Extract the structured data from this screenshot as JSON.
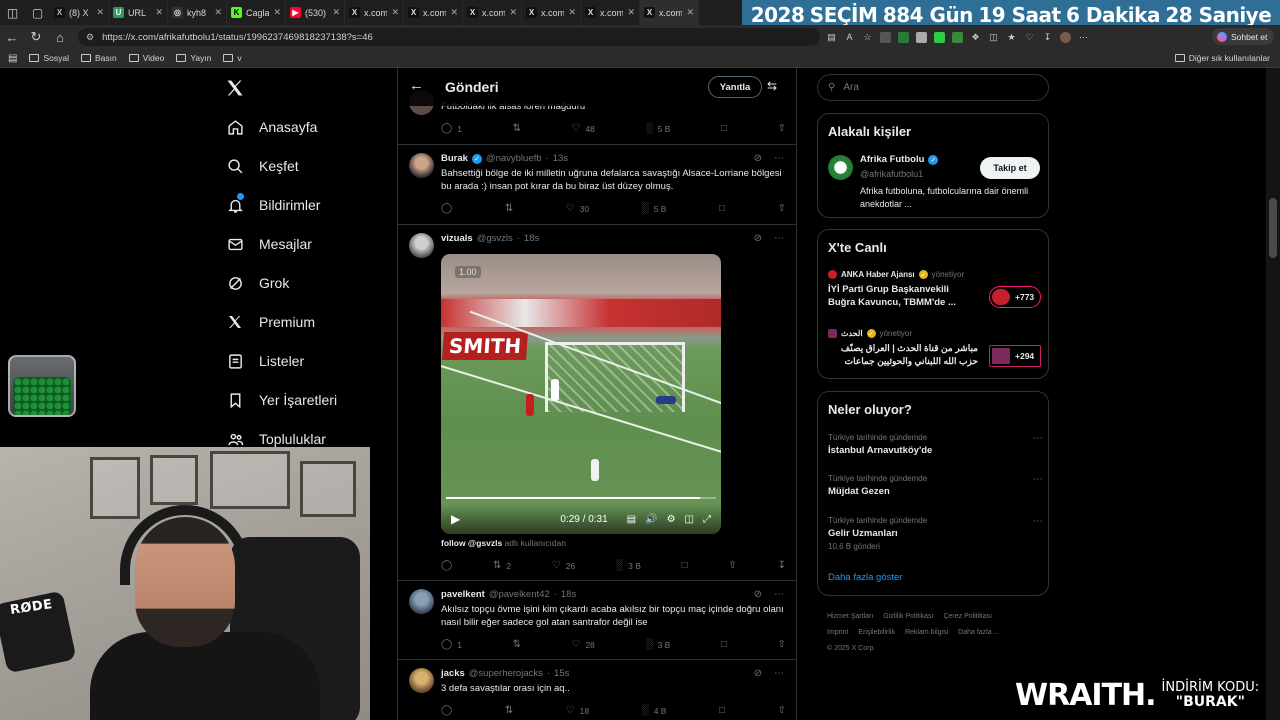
{
  "browser": {
    "tabs": [
      {
        "title": "(8) X",
        "fav": "X",
        "favColor": "#b8b8b8",
        "favBg": "#111"
      },
      {
        "title": "URL",
        "fav": "U",
        "favColor": "#fff",
        "favBg": "#2c9c58"
      },
      {
        "title": "kyh8",
        "fav": "◎",
        "favColor": "#ddd",
        "favBg": "#333"
      },
      {
        "title": "Cagla",
        "fav": "K",
        "favColor": "#000",
        "favBg": "#53fc18"
      },
      {
        "title": "(530)",
        "fav": "▶",
        "favColor": "#fff",
        "favBg": "#ff0033"
      },
      {
        "title": "x.com",
        "fav": "X",
        "favColor": "#ddd",
        "favBg": "#111"
      },
      {
        "title": "x.com",
        "fav": "X",
        "favColor": "#ddd",
        "favBg": "#111"
      },
      {
        "title": "x.com",
        "fav": "X",
        "favColor": "#ddd",
        "favBg": "#111"
      },
      {
        "title": "x.com",
        "fav": "X",
        "favColor": "#ddd",
        "favBg": "#111"
      },
      {
        "title": "x.com",
        "fav": "X",
        "favColor": "#ddd",
        "favBg": "#111"
      },
      {
        "title": "x.com",
        "fav": "X",
        "favColor": "#ddd",
        "favBg": "#111"
      }
    ],
    "url": "https://x.com/afrikafutbolu1/status/1996237469818237138?s=46",
    "bookmarks": [
      "Sosyal",
      "Basın",
      "Video",
      "Yayın",
      "v"
    ],
    "bookmarks_other": "Diğer sık kullanılanlar",
    "chat_label": "Sohbet et"
  },
  "election": {
    "year": "2028",
    "label": "SEÇİM",
    "days": "884 Gün",
    "hours": "19 Saat",
    "minutes": "6 Dakika",
    "seconds": "28 Saniye"
  },
  "nav": {
    "items": [
      {
        "label": "Anasayfa",
        "icon": "home-icon"
      },
      {
        "label": "Keşfet",
        "icon": "search-icon"
      },
      {
        "label": "Bildirimler",
        "icon": "bell-icon"
      },
      {
        "label": "Mesajlar",
        "icon": "mail-icon"
      },
      {
        "label": "Grok",
        "icon": "grok-icon"
      },
      {
        "label": "Premium",
        "icon": "x-icon"
      },
      {
        "label": "Listeler",
        "icon": "list-icon"
      },
      {
        "label": "Yer İşaretleri",
        "icon": "bookmark-icon"
      },
      {
        "label": "Topluluklar",
        "icon": "people-icon"
      }
    ]
  },
  "header": {
    "title": "Gönderi",
    "reply_label": "Yanıtla"
  },
  "tweets": [
    {
      "text": "Futboldaki ilk alsas loren mağduru",
      "replies": "1",
      "retweets": "",
      "likes": "48",
      "views": "5 B"
    },
    {
      "name": "Burak",
      "handle": "@navybluefb",
      "time": "13s",
      "text": "Bahsettiği bölge de iki milletin uğruna defalarca savaştığı Alsace-Lorriane bölgesi bu arada :) insan pot kırar da bu biraz üst düzey olmuş.",
      "replies": "",
      "retweets": "",
      "likes": "30",
      "views": "5 B"
    },
    {
      "name": "vizuals",
      "handle": "@gsvzls",
      "time": "18s",
      "replies": "",
      "retweets": "2",
      "likes": "26",
      "views": "3 B",
      "video": {
        "speed": "1.00",
        "time": "0:29 / 0:31",
        "progress": 0.94,
        "board_text": "SMITH"
      },
      "caption_user": "follow @gsvzls",
      "caption_sub": "adlı kullanıcıdan"
    },
    {
      "name": "pavelkent",
      "handle": "@pavelkent42",
      "time": "18s",
      "text": "Akılsız topçu övme işini kim çıkardı acaba akılsız bir topçu maç içinde doğru olanı nasıl bilir eğer sadece gol atan santrafor değil ise",
      "replies": "1",
      "retweets": "",
      "likes": "28",
      "views": "3 B"
    },
    {
      "name": "jacks",
      "handle": "@superherojacks",
      "time": "15s",
      "text": "3 defa savaştılar orası için aq..",
      "replies": "",
      "retweets": "",
      "likes": "18",
      "views": "4 B"
    }
  ],
  "right": {
    "search_placeholder": "Ara",
    "related_title": "Alakalı kişiler",
    "related": {
      "name": "Afrika Futbolu",
      "handle": "@afrikafutbolu1",
      "bio": "Afrika futboluna, futbolcularına dair önemli anekdotlar ...",
      "follow_label": "Takip et"
    },
    "live_title": "X'te Canlı",
    "live": [
      {
        "source": "ANKA Haber Ajansı",
        "status": "yönetiyor",
        "title": "İYİ Parti Grup Başkanvekili Buğra Kavuncu, TBMM'de ...",
        "count": "+773",
        "thumb": "#c8202a"
      },
      {
        "source": "الحدث",
        "status": "yönetiyor",
        "title": "مباشر من قناة الحدث | العراق يصنّف حزب الله اللبناني والحوثيين جماعات",
        "count": "+294",
        "thumb": "#7a2a5a"
      }
    ],
    "trends_title": "Neler oluyor?",
    "trends": [
      {
        "category": "Türkiye tarihinde gündemde",
        "title": "İstanbul Arnavutköy'de",
        "count": ""
      },
      {
        "category": "Türkiye tarihinde gündemde",
        "title": "Müjdat Gezen",
        "count": ""
      },
      {
        "category": "Türkiye tarihinde gündemde",
        "title": "Gelir Uzmanları",
        "count": "10,6 B gönderi"
      }
    ],
    "show_more": "Daha fazla göster",
    "footer": [
      "Hizmet Şartları",
      "Gizlilik Politikası",
      "Çerez Politikası",
      "Imprint",
      "Erişilebilirlik",
      "Reklam bilgisi",
      "Daha fazla ...",
      "© 2025 X Corp."
    ]
  },
  "stream": {
    "sponsor_brand": "WRAITH.",
    "sponsor_line1": "İNDİRİM KODU:",
    "sponsor_code": "\"BURAK\"",
    "mic_brand": "RØDE"
  },
  "colors": {
    "accent": "#1d9bf0",
    "live": "#f91880",
    "election_bg": "#2f6f96"
  }
}
